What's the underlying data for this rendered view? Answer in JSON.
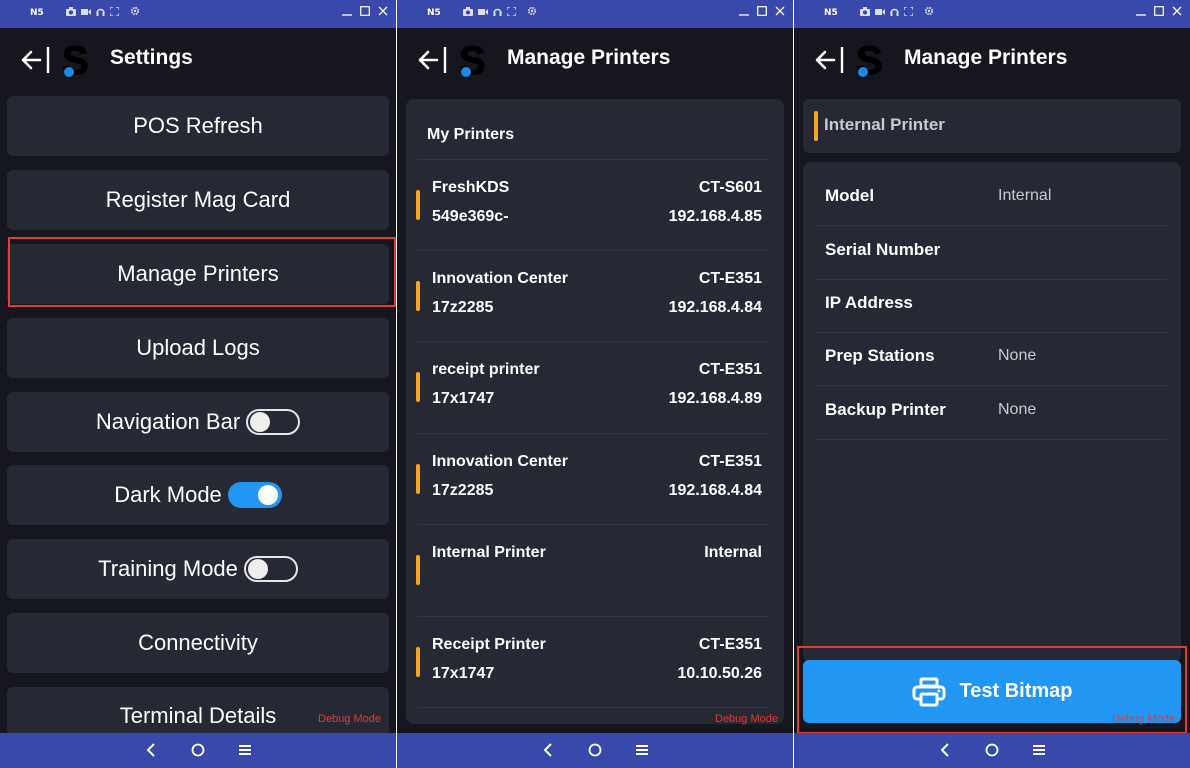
{
  "status_bar": {
    "device": "N5"
  },
  "settings": {
    "title": "Settings",
    "buttons": [
      "POS Refresh",
      "Register Mag Card",
      "Manage Printers",
      "Upload Logs",
      "Navigation Bar",
      "Dark Mode",
      "Training Mode",
      "Connectivity",
      "Terminal Details"
    ],
    "toggles": {
      "navigation_bar": false,
      "dark_mode": true,
      "training_mode": false
    },
    "debug": "Debug Mode"
  },
  "printers": {
    "title": "Manage Printers",
    "section": "My Printers",
    "list": [
      {
        "name": "FreshKDS",
        "id": "549e369c-",
        "model": "CT-S601",
        "ip": "192.168.4.85"
      },
      {
        "name": "Innovation Center",
        "id": "17z2285",
        "model": "CT-E351",
        "ip": "192.168.4.84"
      },
      {
        "name": "receipt printer",
        "id": "17x1747",
        "model": "CT-E351",
        "ip": "192.168.4.89"
      },
      {
        "name": "Innovation Center",
        "id": "17z2285",
        "model": "CT-E351",
        "ip": "192.168.4.84"
      },
      {
        "name": "Internal Printer",
        "id": "",
        "model": "Internal",
        "ip": ""
      },
      {
        "name": "Receipt Printer",
        "id": "17x1747",
        "model": "CT-E351",
        "ip": "10.10.50.26"
      }
    ],
    "debug": "Debug Mode"
  },
  "detail": {
    "title": "Manage Printers",
    "printer_name": "Internal Printer",
    "fields": [
      {
        "label": "Model",
        "value": "Internal"
      },
      {
        "label": "Serial Number",
        "value": ""
      },
      {
        "label": "IP Address",
        "value": ""
      },
      {
        "label": "Prep Stations",
        "value": "None"
      },
      {
        "label": "Backup Printer",
        "value": "None"
      }
    ],
    "test_button": "Test Bitmap",
    "debug": "Debug Mode"
  },
  "colors": {
    "status_bar": "#3949ab",
    "background": "#16171e",
    "card": "#262834",
    "accent": "#f5a623",
    "primary": "#2196f3",
    "highlight": "#e53935"
  }
}
